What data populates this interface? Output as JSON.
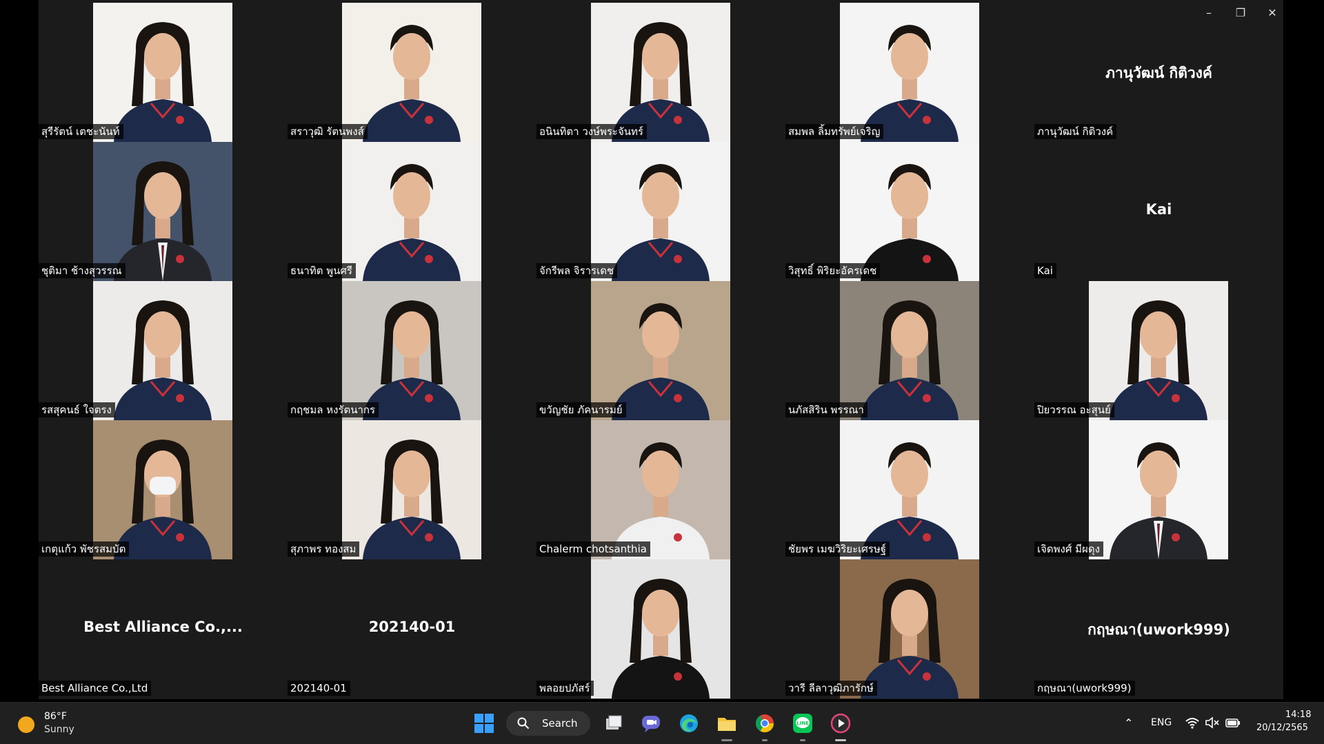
{
  "window": {
    "minimize_icon": "minimize-icon",
    "restore_icon": "restore-icon",
    "close_icon": "close-icon"
  },
  "tiles": [
    {
      "name": "สุรีรัตน์ เตชะนันท์",
      "video": true,
      "shirt": "navy",
      "bg": "#f4f2ef",
      "hair": "long"
    },
    {
      "name": "สราวุฒิ รัตนพงส์",
      "video": true,
      "shirt": "navy",
      "bg": "#f3efe9",
      "hair": "short"
    },
    {
      "name": "อนินทิตา วงษ์พระจันทร์",
      "video": true,
      "shirt": "navy",
      "bg": "#f1efed",
      "hair": "long"
    },
    {
      "name": "สมพล ลิ้มทรัพย์เจริญ",
      "video": true,
      "shirt": "navy",
      "bg": "#f4f4f4",
      "hair": "short"
    },
    {
      "name": "ภานุวัฒน์ กิติวงค์",
      "video": false,
      "display": "ภานุวัฒน์ กิติวงค์"
    },
    {
      "name": "ชุติมา ช้างสุวรรณ",
      "video": true,
      "shirt": "suit",
      "bg": "#44536a",
      "hair": "long"
    },
    {
      "name": "ธนาทิต พูนศรี",
      "video": true,
      "shirt": "navy",
      "bg": "#f2f0ee",
      "hair": "short"
    },
    {
      "name": "จักรีพล จิรารเดช",
      "video": true,
      "shirt": "navy",
      "bg": "#f3f3f3",
      "hair": "short"
    },
    {
      "name": "วิสุทธิ์ พิริยะอัครเดช",
      "video": true,
      "shirt": "black",
      "bg": "#f5f5f5",
      "hair": "short"
    },
    {
      "name": "Kai",
      "video": false,
      "display": "Kai"
    },
    {
      "name": "รสสุคนธ์ ใจตรง",
      "video": true,
      "shirt": "navy",
      "bg": "#ecebea",
      "hair": "long"
    },
    {
      "name": "กฤชมล หงรัตนากร",
      "video": true,
      "shirt": "navy",
      "bg": "#c9c6c2",
      "hair": "long"
    },
    {
      "name": "ขวัญชัย ภัคนารมย์",
      "video": true,
      "shirt": "navy",
      "bg": "#b9a58b",
      "hair": "short"
    },
    {
      "name": "นภัสสิริน พรรณา",
      "video": true,
      "shirt": "navy",
      "bg": "#8c8478",
      "hair": "long"
    },
    {
      "name": "ปิยวรรณ อะสุนย์",
      "video": true,
      "shirt": "navy",
      "bg": "#eeeceb",
      "hair": "long"
    },
    {
      "name": "เกตุแก้ว พัชรสมบัต",
      "video": true,
      "shirt": "navy",
      "bg": "#a88f72",
      "hair": "mask"
    },
    {
      "name": "สุภาพร ทองสม",
      "video": true,
      "shirt": "navy",
      "bg": "#ece7e1",
      "hair": "long"
    },
    {
      "name": "Chalerm chotsanthia",
      "video": true,
      "shirt": "white",
      "bg": "#c4b7ad",
      "hair": "short"
    },
    {
      "name": "ชัยพร เมฆวิริยะเศรษฐ์",
      "video": true,
      "shirt": "navy",
      "bg": "#f3f3f3",
      "hair": "short"
    },
    {
      "name": "เจิดพงศ์ มีผดุง",
      "video": true,
      "shirt": "suit",
      "bg": "#f5f5f5",
      "hair": "short"
    },
    {
      "name": "Best Alliance Co.,Ltd",
      "video": false,
      "display": "Best Alliance Co.,..."
    },
    {
      "name": "202140-01",
      "video": false,
      "display": "202140-01"
    },
    {
      "name": "พลอยปภัสร์",
      "video": true,
      "shirt": "black",
      "bg": "#e5e5e5",
      "hair": "long"
    },
    {
      "name": "วารี ลีลาวุฒิภารักษ์",
      "video": true,
      "shirt": "navy",
      "bg": "#8a6a4b",
      "hair": "long"
    },
    {
      "name": "กฤษณา(uwork999)",
      "video": false,
      "display": "กฤษณา(uwork999)"
    }
  ],
  "taskbar": {
    "weather_temp": "86°F",
    "weather_cond": "Sunny",
    "search_label": "Search",
    "lang": "ENG",
    "time": "14:18",
    "date": "20/12/2565",
    "apps": [
      "windows-start-icon",
      "task-view-icon",
      "chat-icon",
      "edge-icon",
      "file-explorer-icon",
      "chrome-icon",
      "line-icon",
      "media-player-icon"
    ],
    "colors": {
      "start": "#3aa0ff",
      "edge": "#1fa3e0",
      "folder": "#f5c33b",
      "line": "#06c755",
      "media": "#e0457b"
    }
  }
}
